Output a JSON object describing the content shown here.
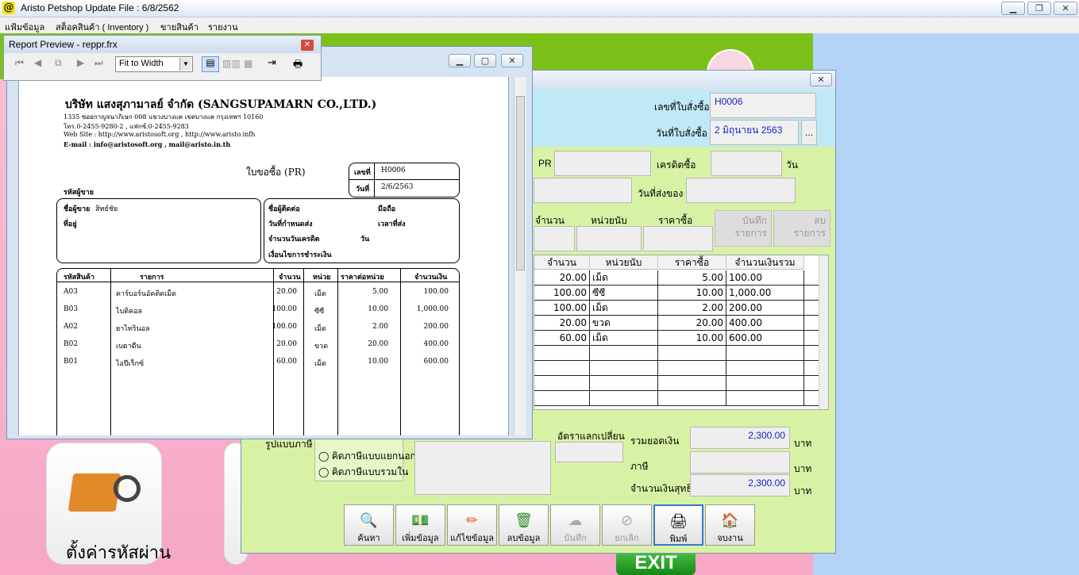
{
  "window": {
    "title": "Aristo Petshop  Update File : 6/8/2562",
    "logo": "@"
  },
  "menu": [
    "แฟ้มข้อมูล",
    "สต็อคสินค้า ( Inventory )",
    "ขายสินค้า",
    "รายงาน"
  ],
  "app_tiles": {
    "tile1_label": "ตั้งค่ารหัสผ่าน",
    "exit_label": "EXIT"
  },
  "po_form": {
    "po_number_label": "เลขที่ใบสั่งซื้อ",
    "po_number": "H0006",
    "po_date_label": "วันที่ใบสั่งซื้อ",
    "po_date": "2 มิถุนายน 2563",
    "date_picker": "...",
    "pr_label": "PR",
    "credit_label": "เครดิตซื้อ",
    "days_unit": "วัน",
    "delivery_label": "วันที่ส่งของ",
    "qty_label": "จำนวน",
    "unit_label": "หน่วยนับ",
    "price_label": "ราคาซื้อ",
    "save_item": [
      "บันทึก",
      "รายการ"
    ],
    "delete_item": [
      "ลบ",
      "รายการ"
    ],
    "grid_headers": [
      "จำนวน",
      "หน่วยนับ",
      "ราคาซื้อ",
      "จำนวนเงินรวม"
    ],
    "rows": [
      {
        "qty": "20.00",
        "unit": "เม็ด",
        "price": "5.00",
        "total": "100.00"
      },
      {
        "qty": "100.00",
        "unit": "ซีซี",
        "price": "10.00",
        "total": "1,000.00"
      },
      {
        "qty": "100.00",
        "unit": "เม็ด",
        "price": "2.00",
        "total": "200.00"
      },
      {
        "qty": "20.00",
        "unit": "ขวด",
        "price": "20.00",
        "total": "400.00"
      },
      {
        "qty": "60.00",
        "unit": "เม็ด",
        "price": "10.00",
        "total": "600.00"
      }
    ],
    "tax_label": "รูปแบบภาษี",
    "tax_options": [
      "คิดภาษีแบบแยกนอก",
      "คิดภาษีแบบรวมใน"
    ],
    "exchange_label": "อัตราแลกเปลี่ยน",
    "sum_label": "รวมยอดเงิน",
    "sum_value": "2,300.00",
    "vat_label": "ภาษี",
    "vat_value": "",
    "net_label": "จำนวนเงินสุทธิ",
    "net_value": "2,300.00",
    "currency": "บาท",
    "buttons": [
      "ค้นหา",
      "เพิ่มข้อมูล",
      "แก้ไขข้อมูล",
      "ลบข้อมูล",
      "บันทึก",
      "ยกเลิก",
      "พิมพ์",
      "จบงาน"
    ]
  },
  "report": {
    "company": "บริษัท แสงสุภามาลย์ จำกัด  (SANGSUPAMARN CO.,LTD.)",
    "address": "1335 ซอยกาญจนาภิเษก 008 แขวงบางแค เขตบางแค กรุงเทพฯ 10160",
    "phone": "โทร.0-2455-9280-2 , แฟกซ์.0-2455-9283",
    "web": "Web Site : http://www.aristosoft.org , http://www.aristo.infh",
    "email": "E-mail : info@aristosoft.org ,  mail@aristo.in.th",
    "doc_title": "ใบขอซื้อ (PR)",
    "no_label": "เลขที่",
    "no_value": "H0006",
    "date_label": "วันที่",
    "date_value": "2/6/2563",
    "vendor_code_label": "รหัสผู้ขาย",
    "vendor_name_label": "ชื่อผู้ขาย",
    "vendor_name": "สิทธ์ชัย",
    "address_label": "ที่อยู่",
    "contact_label": "ชื่อผู้ติดต่อ",
    "mobile_label": "มือถือ",
    "due_label": "วันที่กำหนดส่ง",
    "time_label": "เวลาที่ส่ง",
    "credit_label": "จำนวนวันเครดิต",
    "days": "วัน",
    "terms_label": "เงื่อนไขการชำระเงิน",
    "headers": [
      "รหัสสินค้า",
      "รายการ",
      "จำนวน",
      "หน่วย",
      "ราคาต่อหน่วย",
      "จำนวนเงิน"
    ],
    "items": [
      {
        "code": "A03",
        "name": "คาร์บอร์นอัคติดเม็ด",
        "qty": "20.00",
        "unit": "เม็ด",
        "price": "5.00",
        "total": "100.00"
      },
      {
        "code": "B03",
        "name": "ไบติคอล",
        "qty": "100.00",
        "unit": "ซีซี",
        "price": "10.00",
        "total": "1,000.00"
      },
      {
        "code": "A02",
        "name": "ยาไทรินอล",
        "qty": "100.00",
        "unit": "เม็ด",
        "price": "2.00",
        "total": "200.00"
      },
      {
        "code": "B02",
        "name": "เบตาดีน",
        "qty": "20.00",
        "unit": "ขวด",
        "price": "20.00",
        "total": "400.00"
      },
      {
        "code": "B01",
        "name": "ไอปีเร็กซ์",
        "qty": "60.00",
        "unit": "เม็ด",
        "price": "10.00",
        "total": "600.00"
      }
    ]
  },
  "preview_toolbar": {
    "title": "Report Preview - reppr.frx",
    "zoom": "Fit to Width"
  }
}
